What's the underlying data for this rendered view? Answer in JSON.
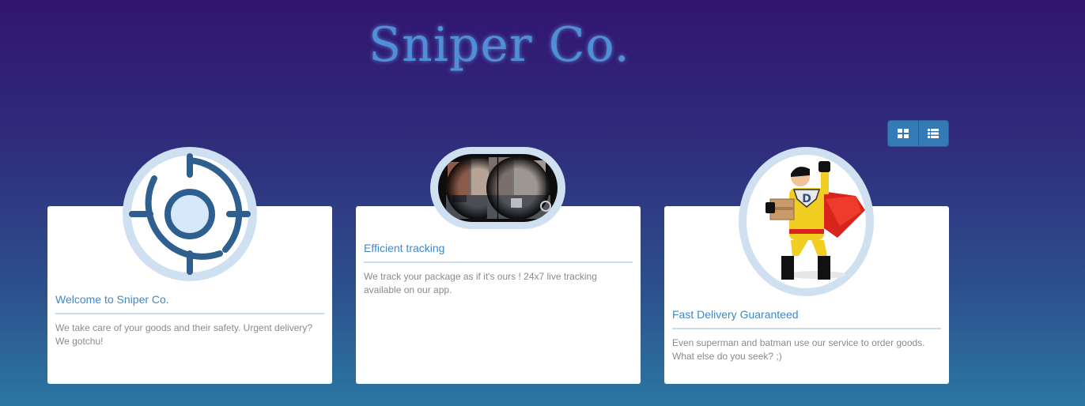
{
  "header": {
    "title": "Sniper Co."
  },
  "view_toggle": {
    "grid_icon": "grid-icon",
    "list_icon": "list-icon"
  },
  "cards": [
    {
      "title": "Welcome to Sniper Co.",
      "text": "We take care of your goods and their safety. Urgent delivery? We gotchu!",
      "icon": "crosshair-icon"
    },
    {
      "title": "Efficient tracking",
      "text": "We track your package as if it's ours ! 24x7 live tracking available on our app.",
      "icon": "scope-view-image"
    },
    {
      "title": "Fast Delivery Guaranteed",
      "text": "Even superman and batman use our service to order goods. What else do you seek? ;)",
      "icon": "superhero-delivery-image"
    }
  ],
  "colors": {
    "accent": "#3f88c9",
    "button": "#337ab7",
    "badge_ring": "#cfe0f1",
    "crosshair": "#2f5f8f"
  }
}
